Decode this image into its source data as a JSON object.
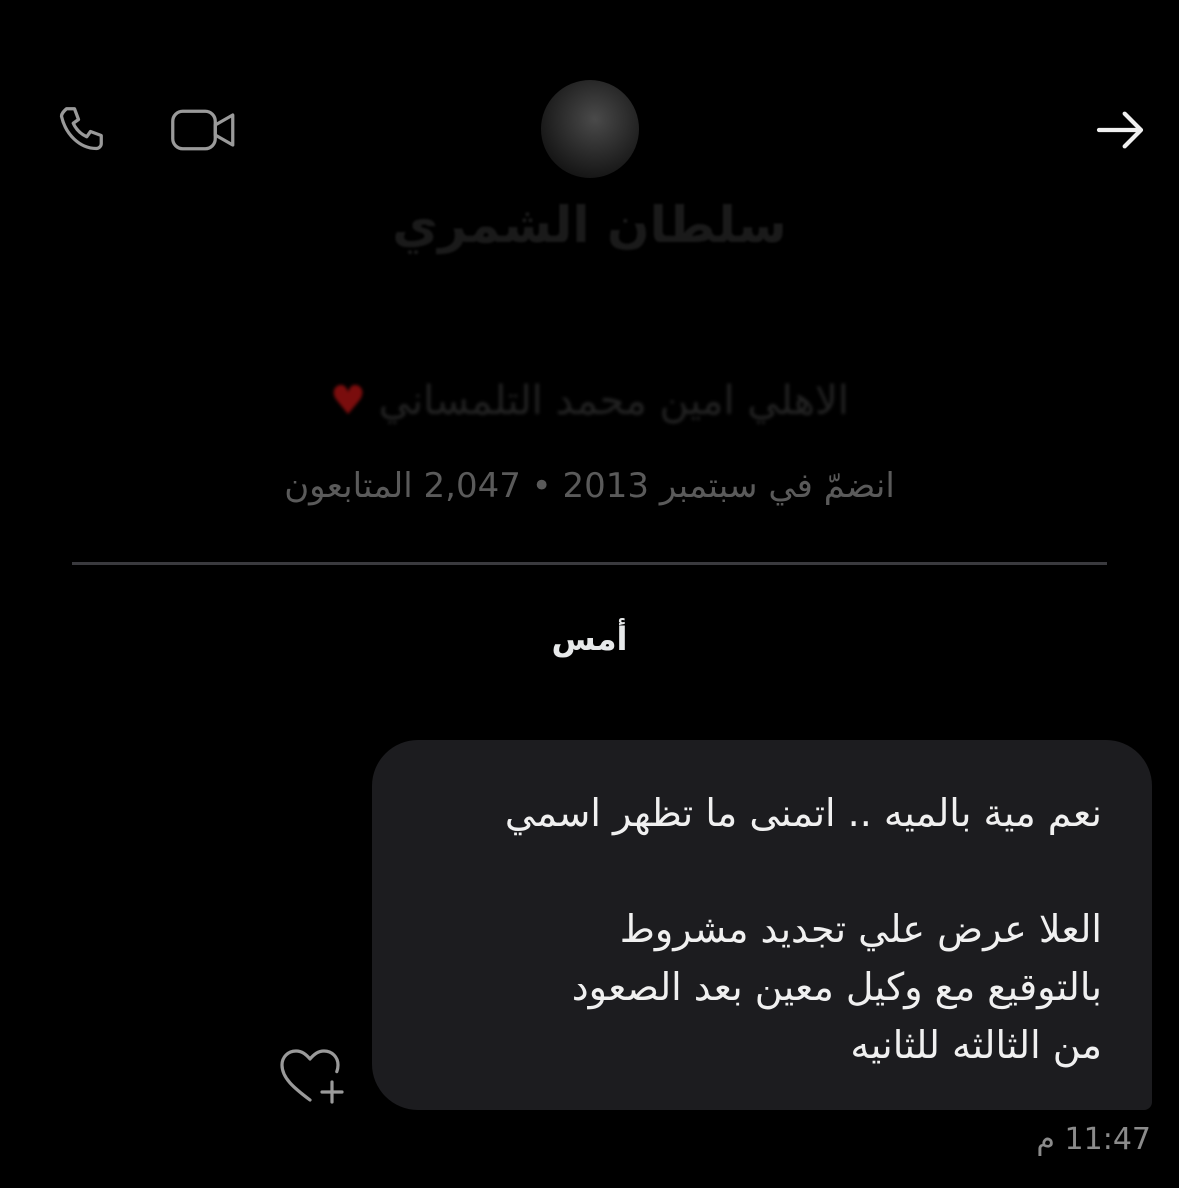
{
  "header": {
    "icons": {
      "call": "phone-icon",
      "video": "video-camera-icon",
      "back": "arrow-right-icon"
    }
  },
  "profile": {
    "name": "سلطان الشمري",
    "bio": "الاهلي امين محمد التلمساني",
    "bio_emoji": "♥",
    "meta": "انضمّ في سبتمبر 2013 • 2,047 المتابعون"
  },
  "conversation": {
    "day_label": "أمس",
    "messages": [
      {
        "lines": [
          "نعم مية بالميه .. اتمنى ما تظهر اسمي",
          "",
          "العلا عرض علي تجديد مشروط",
          "بالتوقيع مع وكيل معين بعد الصعود",
          "من الثالثه للثانيه"
        ],
        "time": "11:47 م"
      }
    ]
  },
  "colors": {
    "background": "#000000",
    "bubble": "#1c1c1f",
    "divider": "#3a3a3e",
    "icon": "#9a9a9a",
    "back_arrow": "#f0f0f0"
  }
}
